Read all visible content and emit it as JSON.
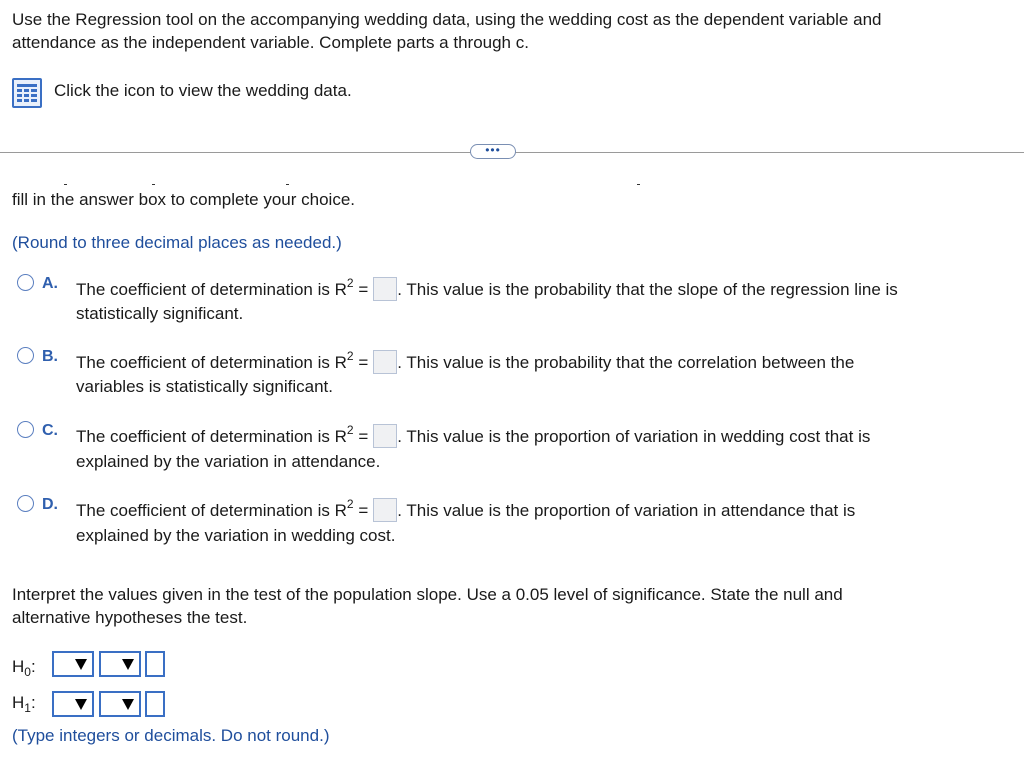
{
  "intro": {
    "line1": "Use the Regression tool on the accompanying wedding data, using the wedding cost as the dependent variable and",
    "line2": "attendance as the independent variable. Complete parts a through c."
  },
  "data_link": {
    "icon": "grid-table-icon",
    "label": "Click the icon to view the wedding data."
  },
  "more_button": {
    "label": "•••"
  },
  "question_part_b": {
    "instruction": "fill in the answer box to complete your choice.",
    "rounding_note": "(Round to three decimal places as needed.)",
    "options": [
      {
        "letter": "A.",
        "prefix": "The coefficient of determination is R",
        "superscript": "2",
        "equals": "=",
        "suffix": ". This value is the probability that the slope of the regression line is",
        "line2": "statistically significant."
      },
      {
        "letter": "B.",
        "prefix": "The coefficient of determination is R",
        "superscript": "2",
        "equals": "=",
        "suffix": ". This value is the probability that the correlation between the",
        "line2": "variables is statistically significant."
      },
      {
        "letter": "C.",
        "prefix": "The coefficient of determination is R",
        "superscript": "2",
        "equals": "=",
        "suffix": ". This value is the proportion of variation in wedding cost that is",
        "line2": "explained by the variation in attendance."
      },
      {
        "letter": "D.",
        "prefix": "The coefficient of determination is R",
        "superscript": "2",
        "equals": "=",
        "suffix": ". This value is the proportion of variation in attendance that is",
        "line2": "explained by the variation in wedding cost."
      }
    ]
  },
  "question_part_c": {
    "line1": "Interpret the values given in the test of the population slope. Use a 0.05 level of significance. State the null and",
    "line2": "alternative hypotheses the test.",
    "h0": {
      "letter": "H",
      "sub": "0",
      "colon": ":"
    },
    "h1": {
      "letter": "H",
      "sub": "1",
      "colon": ":"
    },
    "note": "(Type integers or decimals. Do not round.)"
  }
}
